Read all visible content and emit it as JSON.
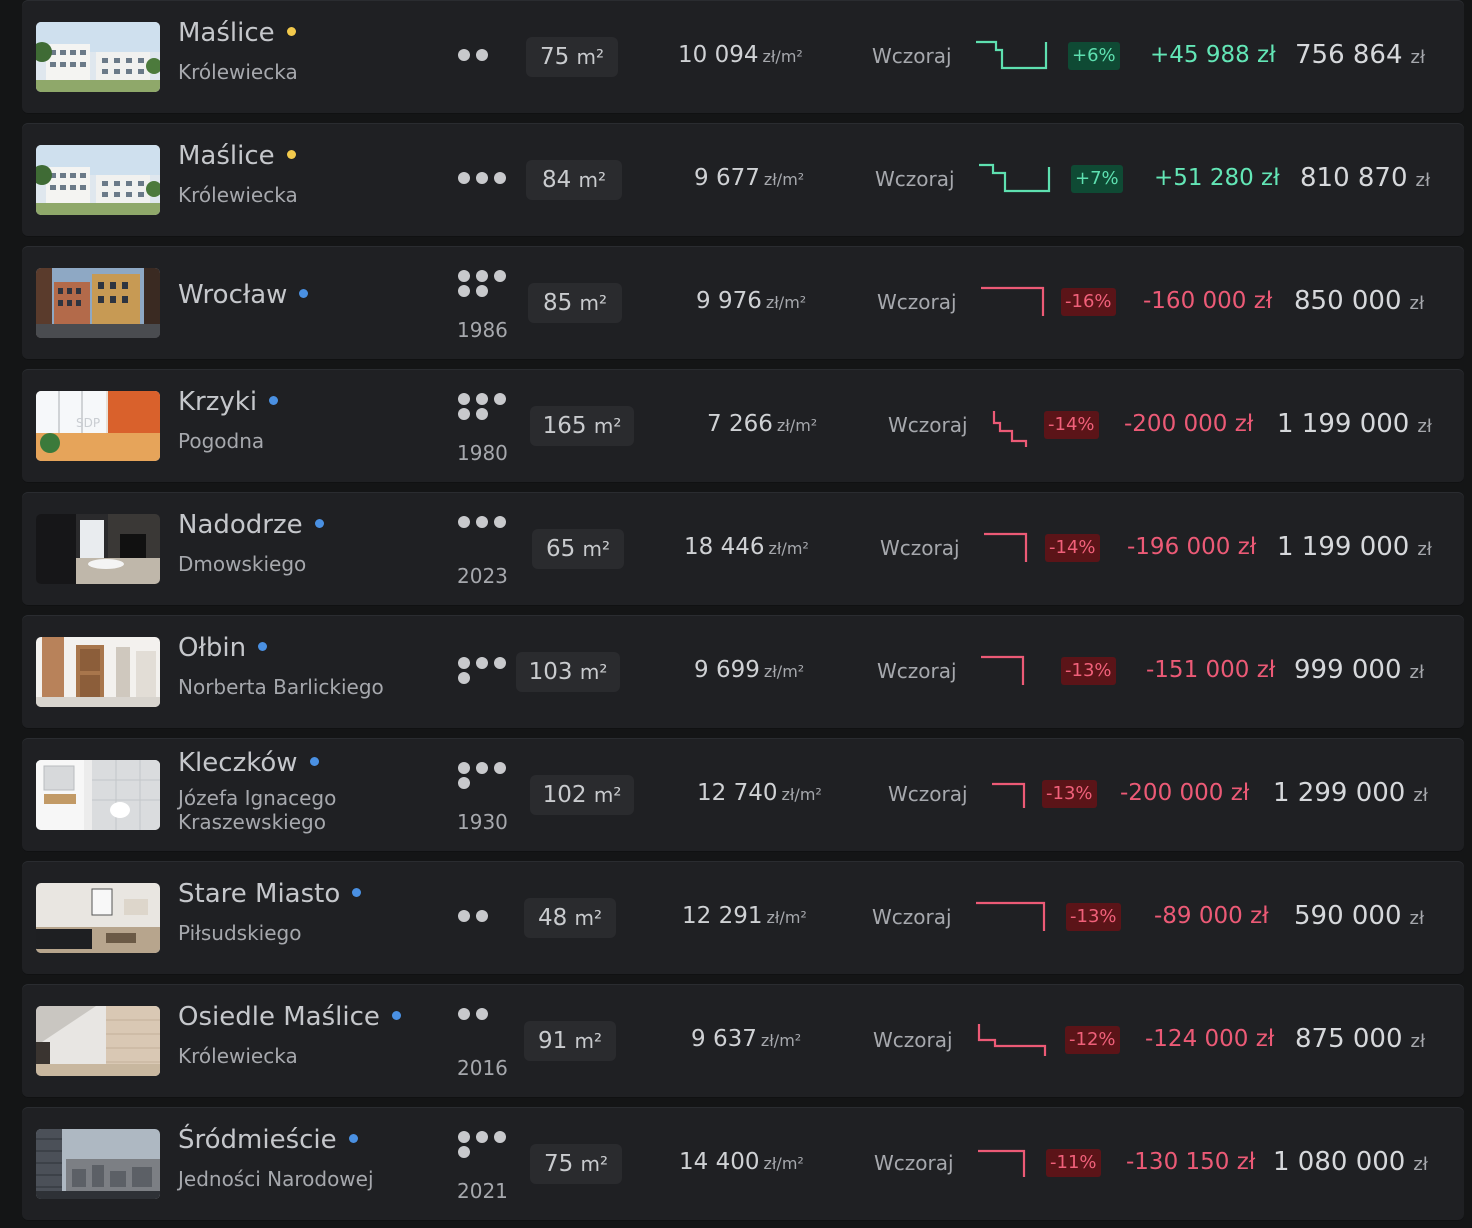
{
  "listings": [
    {
      "district": "Maślice",
      "street": "Królewiecka",
      "dot": "#f2c94c",
      "rooms": 2,
      "year": "",
      "area": "75",
      "ppm": "10 094",
      "when": "Wczoraj",
      "pct": "+6%",
      "change": "+45 988 zł",
      "price": "756 864",
      "trend": "up",
      "thumb": "buildings"
    },
    {
      "district": "Maślice",
      "street": "Królewiecka",
      "dot": "#f2c94c",
      "rooms": 3,
      "year": "",
      "area": "84",
      "ppm": "9 677",
      "when": "Wczoraj",
      "pct": "+7%",
      "change": "+51 280 zł",
      "price": "810 870",
      "trend": "up",
      "thumb": "buildings"
    },
    {
      "district": "Wrocław",
      "street": "",
      "dot": "#4a90e2",
      "rooms": 5,
      "year": "1986",
      "area": "85",
      "ppm": "9 976",
      "when": "Wczoraj",
      "pct": "-16%",
      "change": "-160 000 zł",
      "price": "850 000",
      "trend": "down",
      "thumb": "street"
    },
    {
      "district": "Krzyki",
      "street": "Pogodna",
      "dot": "#4a90e2",
      "rooms": 5,
      "year": "1980",
      "area": "165",
      "ppm": "7 266",
      "when": "Wczoraj",
      "pct": "-14%",
      "change": "-200 000 zł",
      "price": "1 199 000",
      "trend": "down",
      "thumb": "room"
    },
    {
      "district": "Nadodrze",
      "street": "Dmowskiego",
      "dot": "#4a90e2",
      "rooms": 3,
      "year": "2023",
      "area": "65",
      "ppm": "18 446",
      "when": "Wczoraj",
      "pct": "-14%",
      "change": "-196 000 zł",
      "price": "1 199 000",
      "trend": "down",
      "thumb": "dark"
    },
    {
      "district": "Ołbin",
      "street": "Norberta Barlickiego",
      "dot": "#4a90e2",
      "rooms": 4,
      "year": "",
      "area": "103",
      "ppm": "9 699",
      "when": "Wczoraj",
      "pct": "-13%",
      "change": "-151 000 zł",
      "price": "999 000",
      "trend": "down",
      "thumb": "doors"
    },
    {
      "district": "Kleczków",
      "street": "Józefa Ignacego Kraszewskiego",
      "street2": "Kraszewskiego",
      "dot": "#4a90e2",
      "rooms": 4,
      "year": "1930",
      "area": "102",
      "ppm": "12 740",
      "when": "Wczoraj",
      "pct": "-13%",
      "change": "-200 000 zł",
      "price": "1 299 000",
      "trend": "down",
      "thumb": "bath"
    },
    {
      "district": "Stare Miasto",
      "street": "Piłsudskiego",
      "dot": "#4a90e2",
      "rooms": 2,
      "year": "",
      "area": "48",
      "ppm": "12 291",
      "when": "Wczoraj",
      "pct": "-13%",
      "change": "-89 000 zł",
      "price": "590 000",
      "trend": "down",
      "thumb": "living"
    },
    {
      "district": "Osiedle Maślice",
      "street": "Królewiecka",
      "dot": "#4a90e2",
      "rooms": 2,
      "year": "2016",
      "area": "91",
      "ppm": "9 637",
      "when": "Wczoraj",
      "pct": "-12%",
      "change": "-124 000 zł",
      "price": "875 000",
      "trend": "down",
      "thumb": "attic"
    },
    {
      "district": "Śródmieście",
      "street": "Jedności Narodowej",
      "dot": "#4a90e2",
      "rooms": 4,
      "year": "2021",
      "area": "75",
      "ppm": "14 400",
      "when": "Wczoraj",
      "pct": "-11%",
      "change": "-130 150 zł",
      "price": "1 080 000",
      "trend": "down",
      "thumb": "city"
    }
  ],
  "units": {
    "area": "m²",
    "ppm": "zł/m²",
    "price": "zł"
  }
}
